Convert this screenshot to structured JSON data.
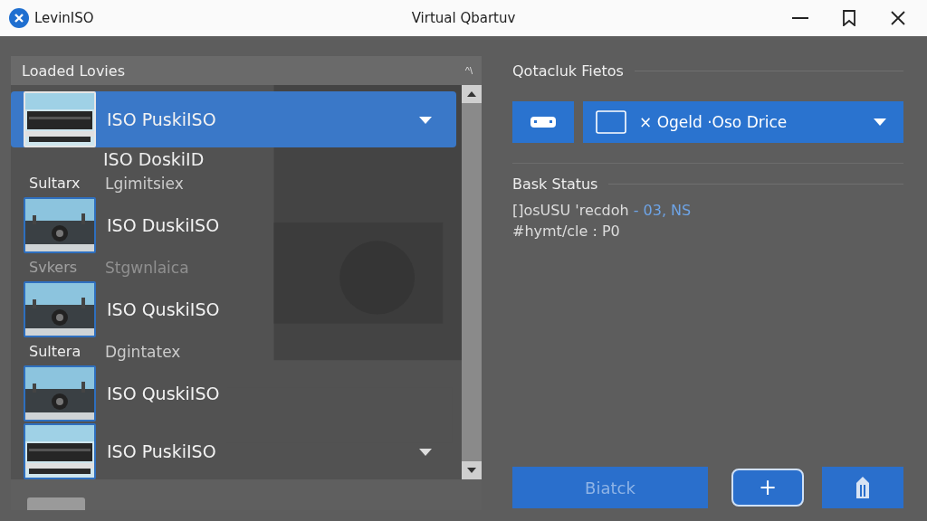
{
  "window": {
    "app_name": "LevinISO",
    "title": "Virtual Qbartuv"
  },
  "library": {
    "title": "Loaded Lovies",
    "collapse_label": "^\\",
    "entries": [
      {
        "kind": "drive",
        "title": "ISO PuskiISO",
        "subtitle": "ISO DoskiID",
        "selected": true,
        "expandable": true
      },
      {
        "kind": "group",
        "label": "Sultarx",
        "name": "Lgimitsiex",
        "faded": false
      },
      {
        "kind": "scene",
        "title": "ISO DuskiISO",
        "selected": false,
        "expandable": false
      },
      {
        "kind": "group",
        "label": "Svkers",
        "name": "Stgwnlaica",
        "faded": true
      },
      {
        "kind": "scene",
        "title": "ISO QuskiISO",
        "selected": false,
        "expandable": false
      },
      {
        "kind": "group",
        "label": "Sultera",
        "name": "Dgintatex",
        "faded": false
      },
      {
        "kind": "scene",
        "title": "ISO QuskiISO",
        "selected": false,
        "expandable": false
      },
      {
        "kind": "drive",
        "title": "ISO PuskiISO",
        "selected": false,
        "expandable": true
      }
    ]
  },
  "drive": {
    "title": "Qotacluk Fietos",
    "selection": "× Ogeld ·Oso Drice"
  },
  "status": {
    "title": "Bask Status",
    "lines": [
      {
        "text": "[]osUSU 'recdoh",
        "highlight": "- 03, NS"
      },
      {
        "text": "#hymt/cle : P0"
      }
    ]
  },
  "actions": {
    "primary": "Biatck",
    "add": "+"
  }
}
